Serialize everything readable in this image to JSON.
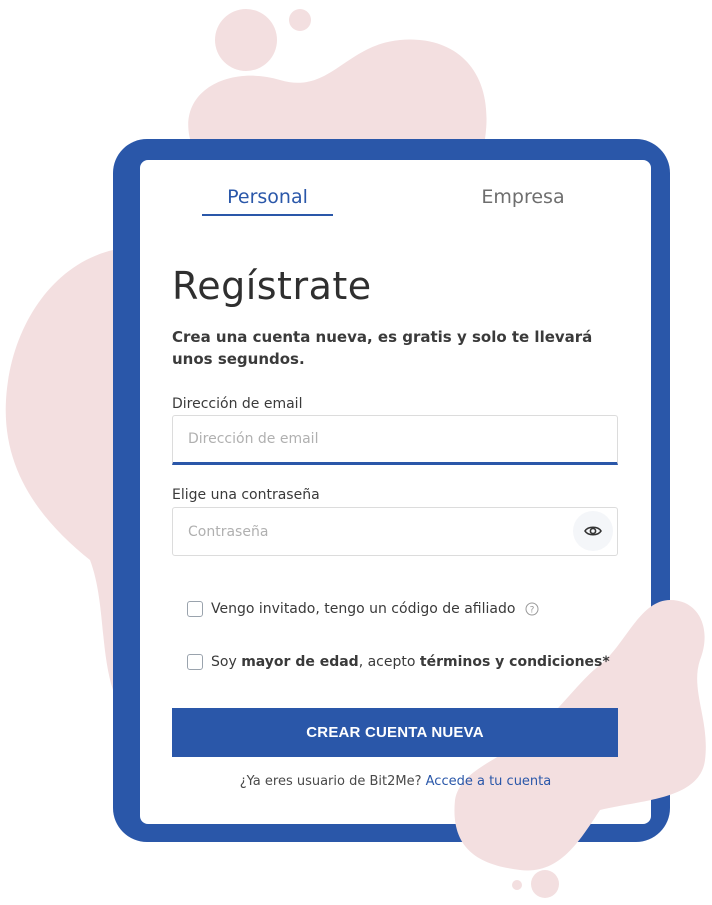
{
  "tabs": [
    {
      "label": "Personal",
      "active": true
    },
    {
      "label": "Empresa",
      "active": false
    }
  ],
  "title": "Regístrate",
  "subtitle": "Crea una cuenta nueva, es gratis y solo te llevará unos segundos.",
  "email": {
    "label": "Dirección de email",
    "placeholder": "Dirección de email",
    "value": ""
  },
  "password": {
    "label": "Elige una contraseña",
    "placeholder": "Contraseña",
    "value": "",
    "toggle_icon": "eye-icon"
  },
  "checkboxes": {
    "afiliado": {
      "label": "Vengo invitado, tengo un código de afiliado",
      "checked": false,
      "help_icon": "question-circle-icon"
    },
    "edad": {
      "prefix": "Soy ",
      "bold1": "mayor de edad",
      "middle": ", acepto ",
      "bold2": "términos y condiciones*",
      "checked": false
    }
  },
  "cta": {
    "label": "CREAR CUENTA NUEVA"
  },
  "footer": {
    "text": "¿Ya eres usuario de Bit2Me? ",
    "link": "Accede a tu cuenta"
  },
  "colors": {
    "brand": "#2a57a9",
    "blob": "#f3dfe0",
    "white": "#ffffff"
  }
}
